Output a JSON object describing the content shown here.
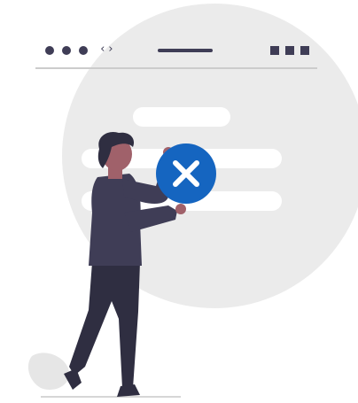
{
  "browser_mock": {
    "nav_glyph": "‹›",
    "window_dots": 3,
    "window_squares": 3
  },
  "error_badge": {
    "icon": "close-icon",
    "color": "#1565c0"
  },
  "colors": {
    "background_circle": "#ebebeb",
    "content_bar": "#ffffff",
    "dark_ink": "#3f3d56",
    "figure_dark": "#2f2e41",
    "skin": "#a0616a",
    "shadow": "#e6e6e6"
  }
}
